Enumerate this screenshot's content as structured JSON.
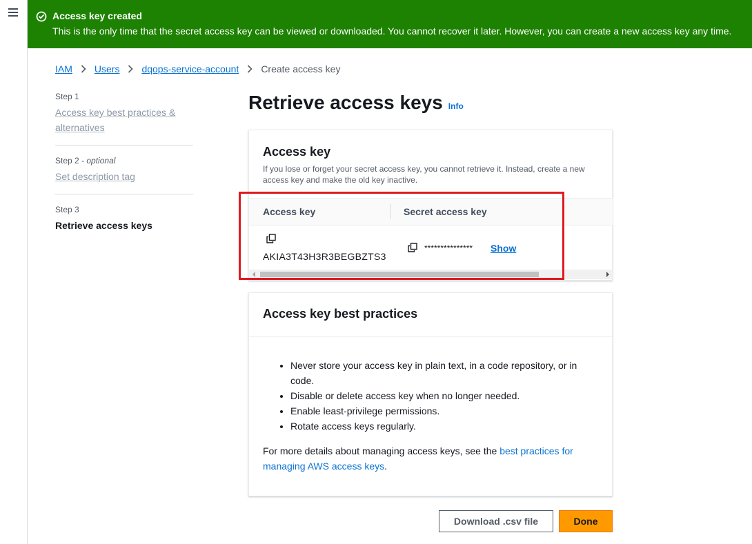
{
  "flash": {
    "title": "Access key created",
    "message": "This is the only time that the secret access key can be viewed or downloaded. You cannot recover it later. However, you can create a new access key any time.",
    "color": "#1d8102"
  },
  "breadcrumb": {
    "items": [
      "IAM",
      "Users",
      "dqops-service-account"
    ],
    "current": "Create access key"
  },
  "steps": [
    {
      "label": "Step 1",
      "title": "Access key best practices & alternatives"
    },
    {
      "label": "Step 2",
      "qualifier": "optional",
      "title": "Set description tag"
    },
    {
      "label": "Step 3",
      "title": "Retrieve access keys"
    }
  ],
  "page": {
    "title": "Retrieve access keys",
    "info": "Info"
  },
  "access_key_card": {
    "title": "Access key",
    "description": "If you lose or forget your secret access key, you cannot retrieve it. Instead, create a new access key and make the old key inactive.",
    "columns": [
      "Access key",
      "Secret access key"
    ],
    "access_key_id": "AKIA3T43H3R3BEGBZTS3",
    "secret_masked": "***************",
    "show_label": "Show"
  },
  "best_practices_card": {
    "title": "Access key best practices",
    "items": [
      "Never store your access key in plain text, in a code repository, or in code.",
      "Disable or delete access key when no longer needed.",
      "Enable least-privilege permissions.",
      "Rotate access keys regularly."
    ],
    "more_prefix": "For more details about managing access keys, see the ",
    "more_link": "best practices for managing AWS access keys",
    "more_suffix": "."
  },
  "actions": {
    "download": "Download .csv file",
    "done": "Done"
  },
  "icons": [
    "menu-icon",
    "check-circle-icon",
    "chevron-right-icon",
    "copy-icon"
  ]
}
